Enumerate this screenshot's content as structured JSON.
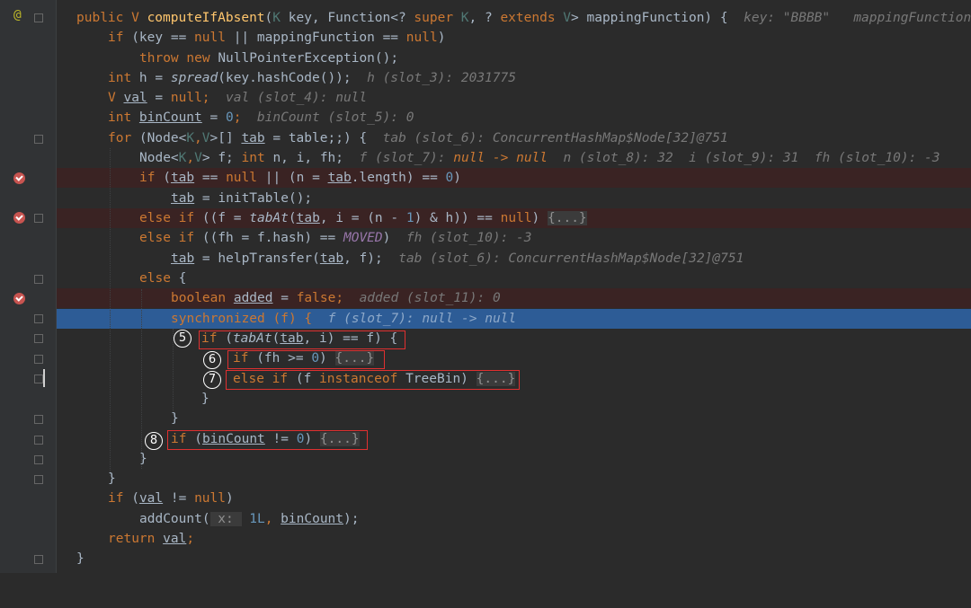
{
  "gutter": {
    "override_marker": "@"
  },
  "lines": {
    "l1": {
      "kw1": "public ",
      "tv": "V ",
      "name": "computeIfAbsent",
      "p1": "(",
      "k1": "K",
      "p2": " key, Function<? ",
      "kw2": "super ",
      "k2": "K",
      "p3": ", ? ",
      "kw3": "extends ",
      "v2": "V",
      "p4": "> mappingFunction) {",
      "hint": "key: \"BBBB\"   mappingFunction: "
    },
    "l2": {
      "kw1": "if ",
      "p1": "(key == ",
      "kw2": "null",
      "p2": " || mappingFunction == ",
      "kw3": "null",
      "p3": ")"
    },
    "l3": {
      "kw1": "throw new ",
      "p1": "NullPointerException();"
    },
    "l4": {
      "kw1": "int ",
      "p1": "h = ",
      "fn": "spread",
      "p2": "(key.hashCode());",
      "hint": "h (slot_3): 2031775"
    },
    "l5": {
      "tv": "V ",
      "var": "val",
      "p1": " = ",
      "kw1": "null",
      "p2": ";",
      "hint": "val (slot_4): null"
    },
    "l6": {
      "kw1": "int ",
      "var": "binCount",
      "p1": " = ",
      "num": "0",
      "p2": ";",
      "hint": "binCount (slot_5): 0"
    },
    "l7": {
      "kw1": "for ",
      "p1": "(Node<",
      "k": "K",
      "c": ",",
      "v": "V",
      "p2": ">[] ",
      "var": "tab",
      "p3": " = table;;) {",
      "hint": "tab (slot_6): ConcurrentHashMap$Node[32]@751"
    },
    "l8": {
      "p1": "Node<",
      "k": "K",
      "c": ",",
      "v": "V",
      "p2": "> f; ",
      "kw1": "int ",
      "p3": "n, i, fh;",
      "hint1": "f (slot_7): ",
      "hintw": "null -> null",
      "hint2": "  n (slot_8): 32  i (slot_9): 31  fh (slot_10): -3"
    },
    "l9": {
      "kw1": "if ",
      "p1": "(",
      "var1": "tab",
      "p2": " == ",
      "kw2": "null",
      "p3": " || (n = ",
      "var2": "tab",
      "p4": ".length) == ",
      "num": "0",
      "p5": ")"
    },
    "l10": {
      "var": "tab",
      "p1": " = initTable();"
    },
    "l11": {
      "kw1": "else if ",
      "p1": "((f = ",
      "fn": "tabAt",
      "p2": "(",
      "var": "tab",
      "p3": ", i = (n - ",
      "num": "1",
      "p4": ") & h)) == ",
      "kw2": "null",
      "p5": ") ",
      "fold": "{...}"
    },
    "l12": {
      "kw1": "else if ",
      "p1": "((fh = f.hash) == ",
      "con": "MOVED",
      "p2": ")",
      "hint": "fh (slot_10): -3"
    },
    "l13": {
      "var1": "tab",
      "p1": " = helpTransfer(",
      "var2": "tab",
      "p2": ", f);",
      "hint": "tab (slot_6): ConcurrentHashMap$Node[32]@751"
    },
    "l14": {
      "kw1": "else ",
      "p1": "{"
    },
    "l15": {
      "kw1": "boolean ",
      "var": "added",
      "p1": " = ",
      "kw2": "false",
      "p2": ";",
      "hint": "added (slot_11): 0"
    },
    "l16": {
      "kw1": "synchronized ",
      "p1": "(f) {",
      "hint": "f (slot_7): null -> null"
    },
    "l17": {
      "kw1": "if ",
      "p1": "(",
      "fn": "tabAt",
      "p2": "(",
      "var": "tab",
      "p3": ", i) == f) {"
    },
    "l18": {
      "kw1": "if ",
      "p1": "(fh >= ",
      "num": "0",
      "p2": ") ",
      "fold": "{...}"
    },
    "l19": {
      "kw1": "else if ",
      "p1": "(f ",
      "kw2": "instanceof ",
      "p2": "TreeBin) ",
      "fold": "{...}"
    },
    "l20": {
      "p1": "}"
    },
    "l21": {
      "p1": "}"
    },
    "l22": {
      "kw1": "if ",
      "p1": "(",
      "var": "binCount",
      "p2": " != ",
      "num": "0",
      "p3": ") ",
      "fold": "{...}"
    },
    "l23": {
      "p1": "}"
    },
    "l24": {
      "p1": "}"
    },
    "l25": {
      "kw1": "if ",
      "p1": "(",
      "var": "val",
      "p2": " != ",
      "kw2": "null",
      "p3": ")"
    },
    "l26": {
      "p1": "addCount(",
      "hint": " x: ",
      "num": "1L",
      "p2": ", ",
      "var": "binCount",
      "p3": ");"
    },
    "l27": {
      "kw1": "return ",
      "var": "val",
      "p1": ";"
    },
    "l28": {
      "p1": "}"
    }
  },
  "annotations": {
    "c5": "5",
    "c6": "6",
    "c7": "7",
    "c8": "8"
  },
  "colors": {
    "keyword": "#cc7832",
    "breakpoint": "#c75450",
    "execution_line": "#2d5c96",
    "highlight_box": "#e03030"
  }
}
